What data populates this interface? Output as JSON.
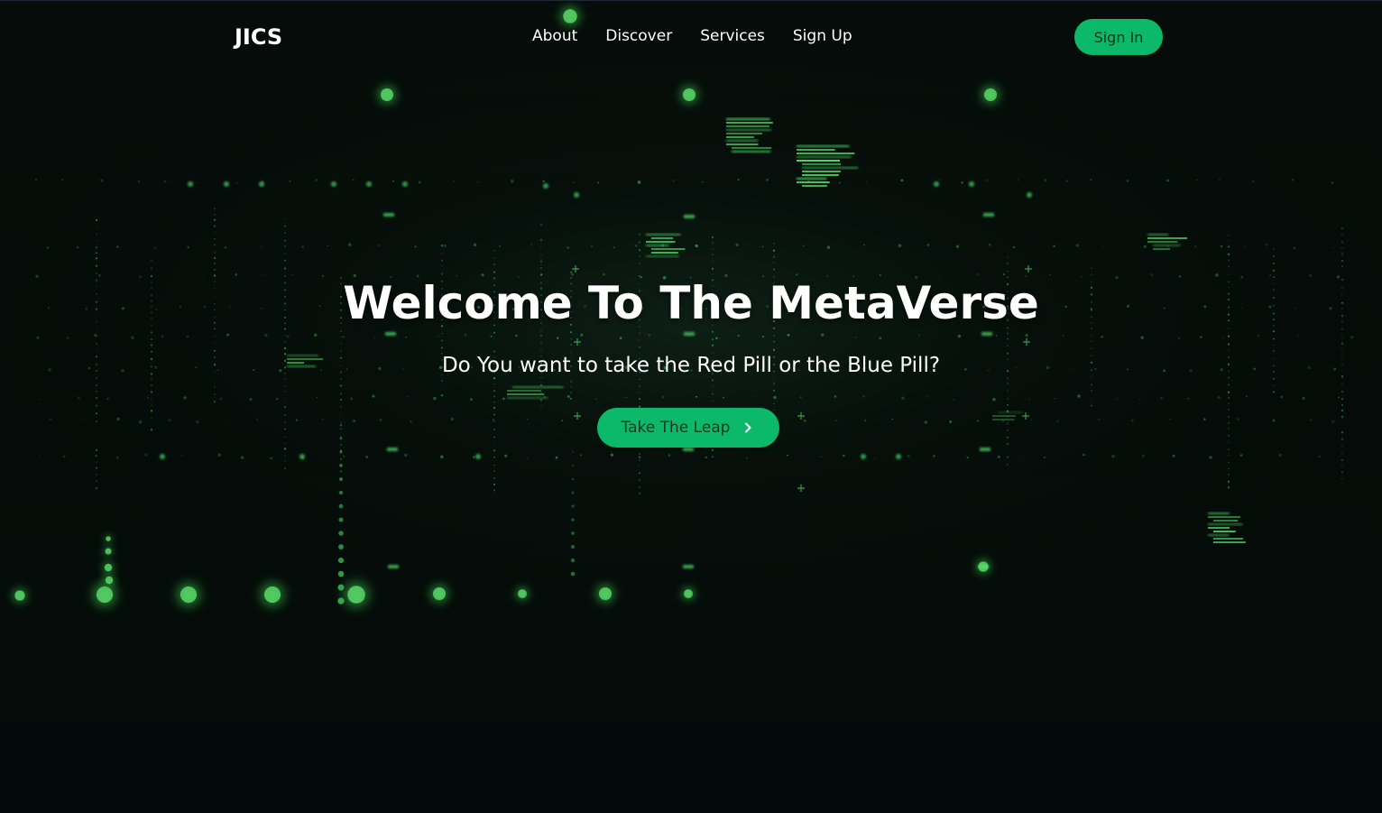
{
  "nav": {
    "logo": "JICS",
    "links": [
      "About",
      "Discover",
      "Services",
      "Sign Up"
    ],
    "sign_in": "Sign In"
  },
  "hero": {
    "title": "Welcome To The MetaVerse",
    "subtitle": "Do You want to take the Red Pill or the Blue Pill?",
    "cta_label": "Take The Leap",
    "cta_icon": "chevron-right-icon"
  },
  "colors": {
    "accent": "#0cb96a",
    "background": "#040a08",
    "glow": "#4cd964"
  }
}
